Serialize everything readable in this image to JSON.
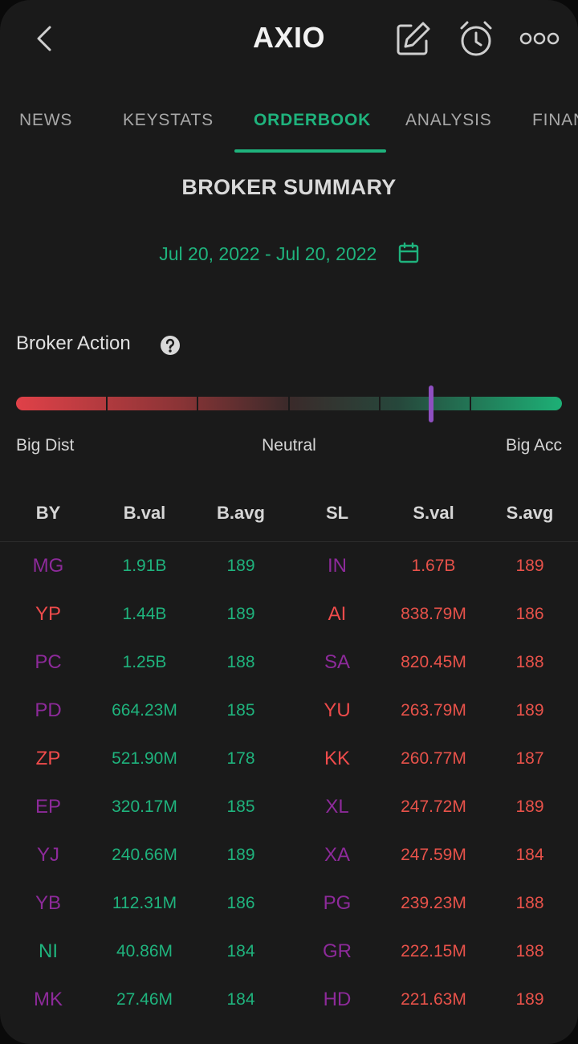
{
  "header": {
    "title": "AXIO",
    "icons": [
      "back-arrow-icon",
      "edit-icon",
      "alarm-icon",
      "more-icon"
    ]
  },
  "tabs": [
    {
      "label": "NEWS",
      "active": false
    },
    {
      "label": "KEYSTATS",
      "active": false
    },
    {
      "label": "ORDERBOOK",
      "active": true
    },
    {
      "label": "ANALYSIS",
      "active": false
    },
    {
      "label": "FINAN",
      "active": false
    }
  ],
  "summary": {
    "title": "BROKER SUMMARY",
    "date_range": "Jul 20, 2022 - Jul 20, 2022"
  },
  "broker_action": {
    "label": "Broker Action",
    "left_label": "Big Dist",
    "center_label": "Neutral",
    "right_label": "Big Acc",
    "level": 0.76
  },
  "colors": {
    "accent_green": "#1fb37d",
    "sell_red": "#e8524a",
    "broker_purple": "#8d2a9a",
    "broker_coral": "#ef4b4b",
    "marker_purple": "#8e4fc0"
  },
  "table": {
    "headers": [
      "BY",
      "B.val",
      "B.avg",
      "SL",
      "S.val",
      "S.avg"
    ],
    "rows": [
      {
        "by": "MG",
        "by_color": "purple",
        "bval": "1.91B",
        "bavg": "189",
        "sl": "IN",
        "sl_color": "purple",
        "sval": "1.67B",
        "savg": "189"
      },
      {
        "by": "YP",
        "by_color": "coral",
        "bval": "1.44B",
        "bavg": "189",
        "sl": "AI",
        "sl_color": "coral",
        "sval": "838.79M",
        "savg": "186"
      },
      {
        "by": "PC",
        "by_color": "purple",
        "bval": "1.25B",
        "bavg": "188",
        "sl": "SA",
        "sl_color": "purple",
        "sval": "820.45M",
        "savg": "188"
      },
      {
        "by": "PD",
        "by_color": "purple",
        "bval": "664.23M",
        "bavg": "185",
        "sl": "YU",
        "sl_color": "coral",
        "sval": "263.79M",
        "savg": "189"
      },
      {
        "by": "ZP",
        "by_color": "coral",
        "bval": "521.90M",
        "bavg": "178",
        "sl": "KK",
        "sl_color": "coral",
        "sval": "260.77M",
        "savg": "187"
      },
      {
        "by": "EP",
        "by_color": "purple",
        "bval": "320.17M",
        "bavg": "185",
        "sl": "XL",
        "sl_color": "purple",
        "sval": "247.72M",
        "savg": "189"
      },
      {
        "by": "YJ",
        "by_color": "purple",
        "bval": "240.66M",
        "bavg": "189",
        "sl": "XA",
        "sl_color": "purple",
        "sval": "247.59M",
        "savg": "184"
      },
      {
        "by": "YB",
        "by_color": "purple",
        "bval": "112.31M",
        "bavg": "186",
        "sl": "PG",
        "sl_color": "purple",
        "sval": "239.23M",
        "savg": "188"
      },
      {
        "by": "NI",
        "by_color": "teal",
        "bval": "40.86M",
        "bavg": "184",
        "sl": "GR",
        "sl_color": "purple",
        "sval": "222.15M",
        "savg": "188"
      },
      {
        "by": "MK",
        "by_color": "purple",
        "bval": "27.46M",
        "bavg": "184",
        "sl": "HD",
        "sl_color": "purple",
        "sval": "221.63M",
        "savg": "189"
      }
    ]
  }
}
